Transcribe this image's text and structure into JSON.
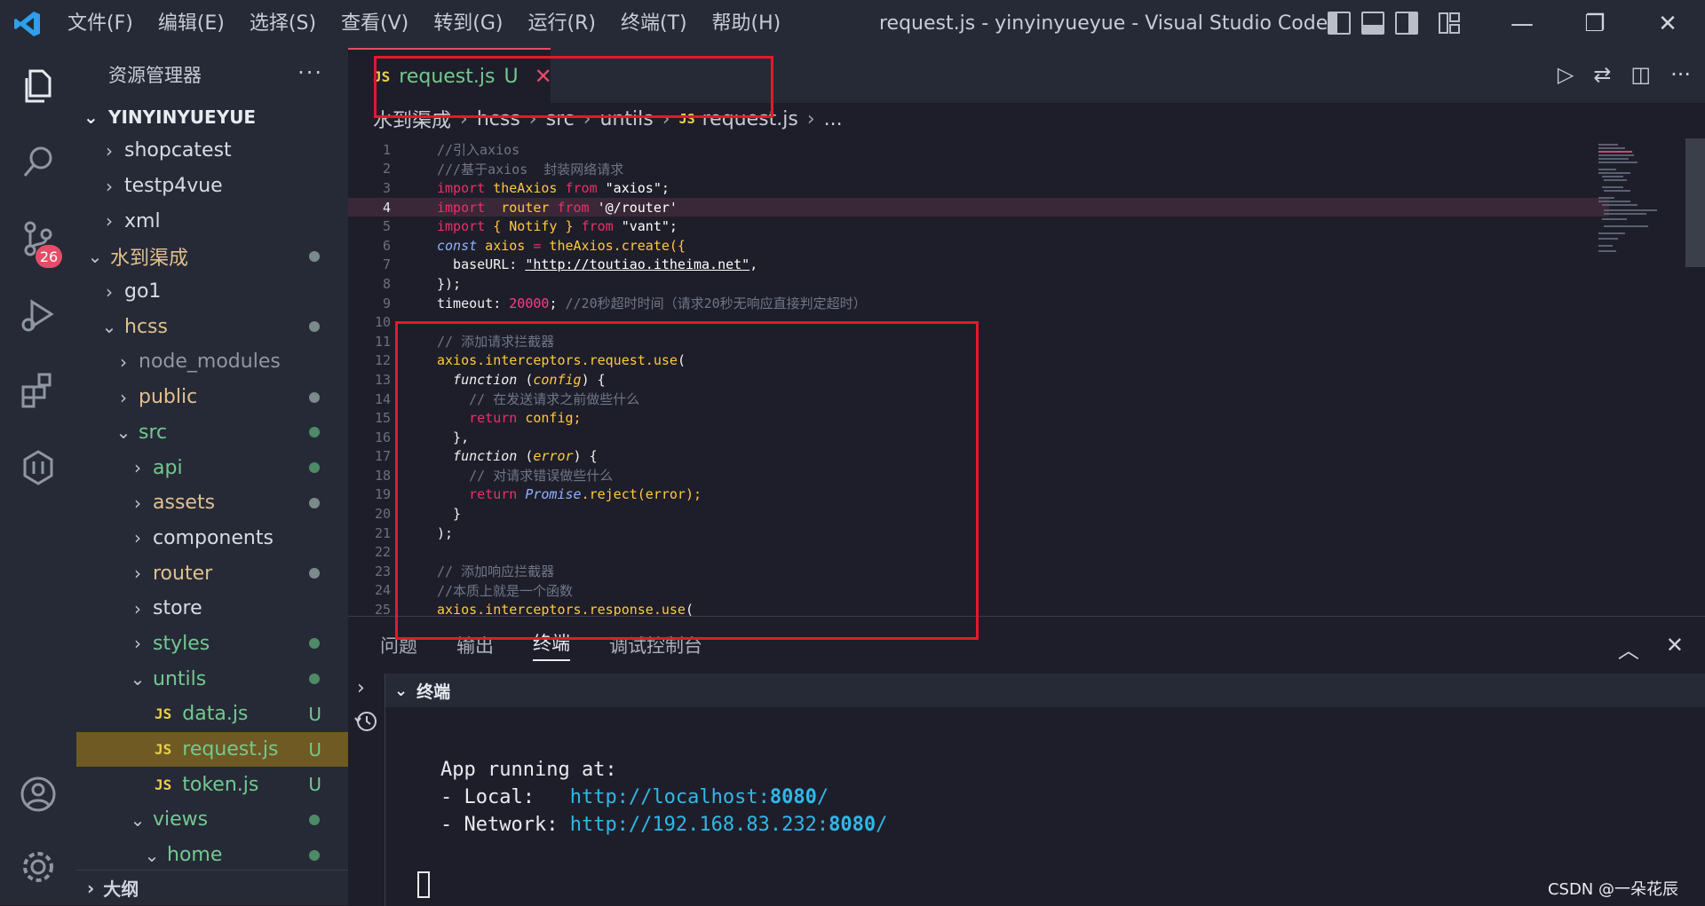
{
  "titlebar": {
    "menu": [
      "文件(F)",
      "编辑(E)",
      "选择(S)",
      "查看(V)",
      "转到(G)",
      "运行(R)",
      "终端(T)",
      "帮助(H)"
    ],
    "title": "request.js - yinyinyueyue - Visual Studio Code",
    "minimize": "—",
    "restore": "❐",
    "close": "✕"
  },
  "activity": {
    "source_control_badge": "26"
  },
  "sidebar": {
    "title": "资源管理器",
    "more": "···",
    "root": "YINYINYUEYUE",
    "items": [
      {
        "label": "shopcatest"
      },
      {
        "label": "testp4vue"
      },
      {
        "label": "xml"
      },
      {
        "label": "水到渠成"
      },
      {
        "label": "go1"
      },
      {
        "label": "hcss"
      },
      {
        "label": "node_modules"
      },
      {
        "label": "public"
      },
      {
        "label": "src"
      },
      {
        "label": "api"
      },
      {
        "label": "assets"
      },
      {
        "label": "components"
      },
      {
        "label": "router"
      },
      {
        "label": "store"
      },
      {
        "label": "styles"
      },
      {
        "label": "untils"
      },
      {
        "label": "data.js",
        "status": "U"
      },
      {
        "label": "request.js",
        "status": "U"
      },
      {
        "label": "token.js",
        "status": "U"
      },
      {
        "label": "views"
      },
      {
        "label": "home"
      }
    ],
    "outline": "大纲"
  },
  "tab": {
    "label": "request.js",
    "status": "U",
    "close": "✕",
    "js": "JS"
  },
  "breadcrumb": [
    "水到渠成",
    "hcss",
    "src",
    "untils",
    "request.js",
    "..."
  ],
  "code": {
    "line_numbers": [
      "1",
      "2",
      "3",
      "4",
      "5",
      "6",
      "7",
      "8",
      "9",
      "10",
      "11",
      "12",
      "13",
      "14",
      "15",
      "16",
      "17",
      "18",
      "19",
      "20",
      "21",
      "22",
      "23",
      "24",
      "25"
    ],
    "l1": "//引入axios",
    "l2": "///基于axios  封装网络请求",
    "l3a": "import",
    "l3b": " theAxios ",
    "l3c": "from",
    "l3d": " \"axios\";",
    "l4a": "import",
    "l4b": "  router ",
    "l4c": "from",
    "l4d": " '@/router'",
    "l5a": "import",
    "l5b": " { Notify } ",
    "l5c": "from",
    "l5d": " \"vant\";",
    "l6a": "const",
    "l6b": " axios ",
    "l6c": "=",
    "l6d": " theAxios.create({",
    "l7a": "  baseURL: ",
    "l7b": "\"http://toutiao.itheima.net\"",
    "l7c": ",",
    "l8": "});",
    "l9a": "timeout: ",
    "l9b": "20000",
    "l9c": "; ",
    "l9d": "//20秒超时时间（请求20秒无响应直接判定超时）",
    "l10": "",
    "l11": "// 添加请求拦截器",
    "l12a": "axios.interceptors.request.",
    "l12b": "use",
    "l12c": "(",
    "l13a": "  function",
    "l13b": " (",
    "l13c": "config",
    "l13d": ") {",
    "l14": "    // 在发送请求之前做些什么",
    "l15a": "    return",
    "l15b": " config;",
    "l16": "  },",
    "l17a": "  function",
    "l17b": " (",
    "l17c": "error",
    "l17d": ") {",
    "l18": "    // 对请求错误做些什么",
    "l19a": "    return",
    "l19b": " Promise",
    "l19c": ".reject(error);",
    "l20": "  }",
    "l21": ");",
    "l22": "",
    "l23": "// 添加响应拦截器",
    "l24": "//本质上就是一个函数",
    "l25a": "axios.interceptors.response.",
    "l25b": "use",
    "l25c": "("
  },
  "panel": {
    "tabs": [
      "问题",
      "输出",
      "终端",
      "调试控制台"
    ],
    "terminal_title": "终端",
    "lines": {
      "running": "App running at:",
      "local_label": "- Local:   ",
      "local_url": "http://localhost:",
      "local_port": "8080",
      "local_tail": "/",
      "network_label": "- Network: ",
      "network_url": "http://192.168.83.232:",
      "network_port": "8080",
      "network_tail": "/"
    }
  },
  "watermark": "CSDN @一朵花辰",
  "colors": {
    "accent_red": "#e3192b",
    "git_untracked": "#73c991",
    "git_modified": "#e2c08d"
  }
}
